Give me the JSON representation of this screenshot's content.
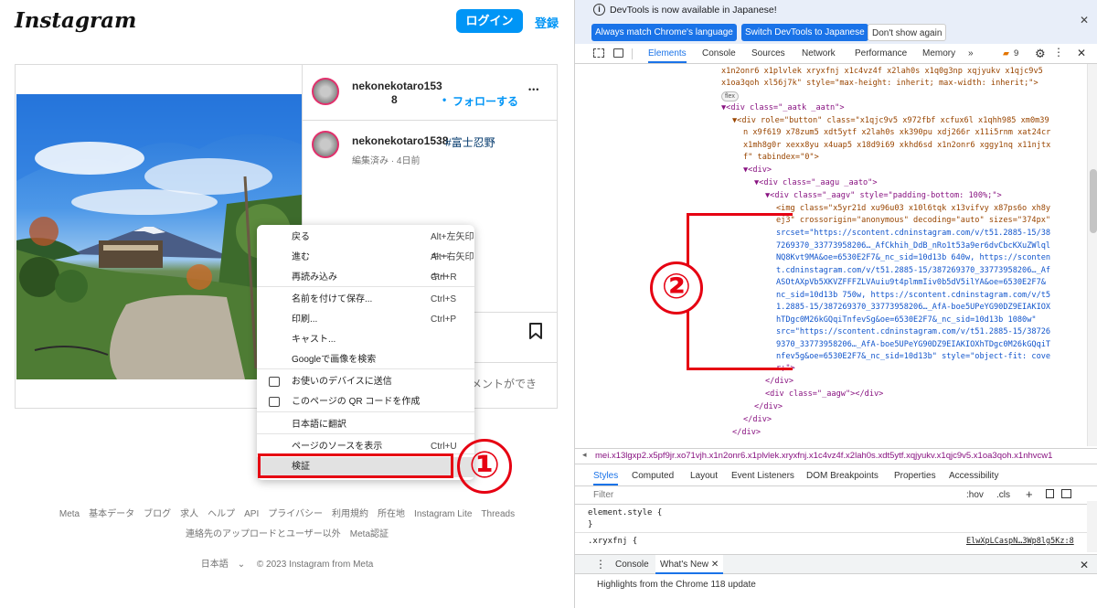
{
  "instagram": {
    "logo": "Instagram",
    "login_button": "ログイン",
    "signup_link": "登録",
    "post": {
      "username": "nekonekotaro153",
      "username_wrap": "8",
      "follow_dot": "•",
      "follow_label": "フォローする",
      "more_label": "•••",
      "caption_user": "nekonekotaro1538",
      "caption_hashtag": "#富士忍野",
      "caption_meta": "編集済み · 4日前",
      "comment_placeholder": "メントができ",
      "bookmark_icon": "bookmark-icon"
    },
    "footer": {
      "links": [
        "Meta",
        "基本データ",
        "ブログ",
        "求人",
        "ヘルプ",
        "API",
        "プライバシー",
        "利用規約",
        "所在地",
        "Instagram Lite",
        "Threads"
      ],
      "line2": [
        "連絡先のアップロードとユーザー以外",
        "Meta認証"
      ],
      "language": "日本語",
      "copyright": "© 2023 Instagram from Meta"
    }
  },
  "context_menu": {
    "items": [
      {
        "label": "戻る",
        "shortcut": "Alt+左矢印キー"
      },
      {
        "label": "進む",
        "shortcut": "Alt+右矢印キー"
      },
      {
        "label": "再読み込み",
        "shortcut": "Ctrl+R"
      },
      {
        "label": "名前を付けて保存...",
        "shortcut": "Ctrl+S"
      },
      {
        "label": "印刷...",
        "shortcut": "Ctrl+P"
      },
      {
        "label": "キャスト...",
        "shortcut": ""
      },
      {
        "label": "Googleで画像を検索",
        "shortcut": ""
      },
      {
        "label": "お使いのデバイスに送信",
        "shortcut": ""
      },
      {
        "label": "このページの QR コードを作成",
        "shortcut": ""
      },
      {
        "label": "日本語に翻訳",
        "shortcut": ""
      },
      {
        "label": "ページのソースを表示",
        "shortcut": "Ctrl+U"
      },
      {
        "label": "検証",
        "shortcut": ""
      }
    ]
  },
  "annotations": {
    "step1": "①",
    "step2": "②"
  },
  "devtools": {
    "banner": {
      "message": "DevTools is now available in Japanese!",
      "btn_match": "Always match Chrome's language",
      "btn_switch": "Switch DevTools to Japanese",
      "btn_dismiss": "Don't show again",
      "close": "✕"
    },
    "tabs": [
      "Elements",
      "Console",
      "Sources",
      "Network",
      "Performance",
      "Memory",
      "»"
    ],
    "issues_count": "9",
    "code": [
      "x1n2onr6 x1plvlek xryxfnj x1c4vz4f x2lah0s x1q0g3np xqjyukv x1qjc9v5",
      "x1oa3qoh xl56j7k\" style=\"max-height: inherit; max-width: inherit;\">",
      "flex",
      "▼<div class=\"_aatk _aatn\">",
      "▼<div role=\"button\" class=\"x1qjc9v5 x972fbf xcfux6l x1qhh985 xm0m39",
      "n x9f619 x78zum5 xdt5ytf x2lah0s xk390pu xdj266r x11i5rnm xat24cr",
      "x1mh8g0r xexx8yu x4uap5 x18d9i69 xkhd6sd x1n2onr6 xggy1nq x11njtx",
      "f\" tabindex=\"0\">",
      "▼<div>",
      "▼<div class=\"_aagu _aato\">",
      "▼<div class=\"_aagv\" style=\"padding-bottom: 100%;\">",
      "<img class=\"x5yr21d xu96u03 x10l6tqk x13vifvy x87ps6o xh8y",
      "ej3\" crossorigin=\"anonymous\" decoding=\"auto\" sizes=\"374px\"",
      "srcset=\"https://scontent.cdninstagram.com/v/t51.2885-15/38",
      "7269370_33773958206…_AfCkhih_DdB_nRo1t53a9er6dvCbcKXuZWlql",
      "NQ8Kvt9MA&oe=6530E2F7&_nc_sid=10d13b 640w, https://sconten",
      "t.cdninstagram.com/v/t51.2885-15/387269370_33773958206…_Af",
      "ASOtAXpVb5XKVZFFFZLVAuiu9t4plmmIiv0b5dV5ilYA&oe=6530E2F7&",
      "nc_sid=10d13b 750w, https://scontent.cdninstagram.com/v/t5",
      "1.2885-15/387269370_33773958206…_AfA-boe5UPeYG90DZ9EIAKIOX",
      "hTDgc0M26kGQqiTnfevSg&oe=6530E2F7&_nc_sid=10d13b 1080w\"",
      "src=\"https://scontent.cdninstagram.com/v/t51.2885-15/38726",
      "9370_33773958206…_AfA-boe5UPeYG90DZ9EIAKIOXhTDgc0M26kGQqiT",
      "nfev5g&oe=6530E2F7&_nc_sid=10d13b\" style=\"object-fit: cove",
      "r;\">",
      "</div>",
      "<div class=\"_aagw\"></div>",
      "</div>",
      "</div>",
      "</div>"
    ],
    "breadcrumb": "mei.x13lgxp2.x5pf9jr.xo71vjh.x1n2onr6.x1plvlek.xryxfnj.x1c4vz4f.x2lah0s.xdt5ytf.xqjyukv.x1qjc9v5.x1oa3qoh.x1nhvcw1",
    "styles_tabs": [
      "Styles",
      "Computed",
      "Layout",
      "Event Listeners",
      "DOM Breakpoints",
      "Properties",
      "Accessibility"
    ],
    "filter_placeholder": "Filter",
    "filter_hov": ":hov",
    "filter_cls": ".cls",
    "styles_lines": [
      "element.style {",
      "}",
      ".xryxfnj {",
      "ElwXpLCaspN…3Wp8lg5Kz:8"
    ],
    "drawer_tabs": [
      "Console",
      "What's New"
    ],
    "drawer_message": "Highlights from the Chrome 118 update"
  },
  "colors": {
    "accent": "#0095f6",
    "annotation": "#e60012",
    "devtools_blue": "#1a73e8"
  }
}
